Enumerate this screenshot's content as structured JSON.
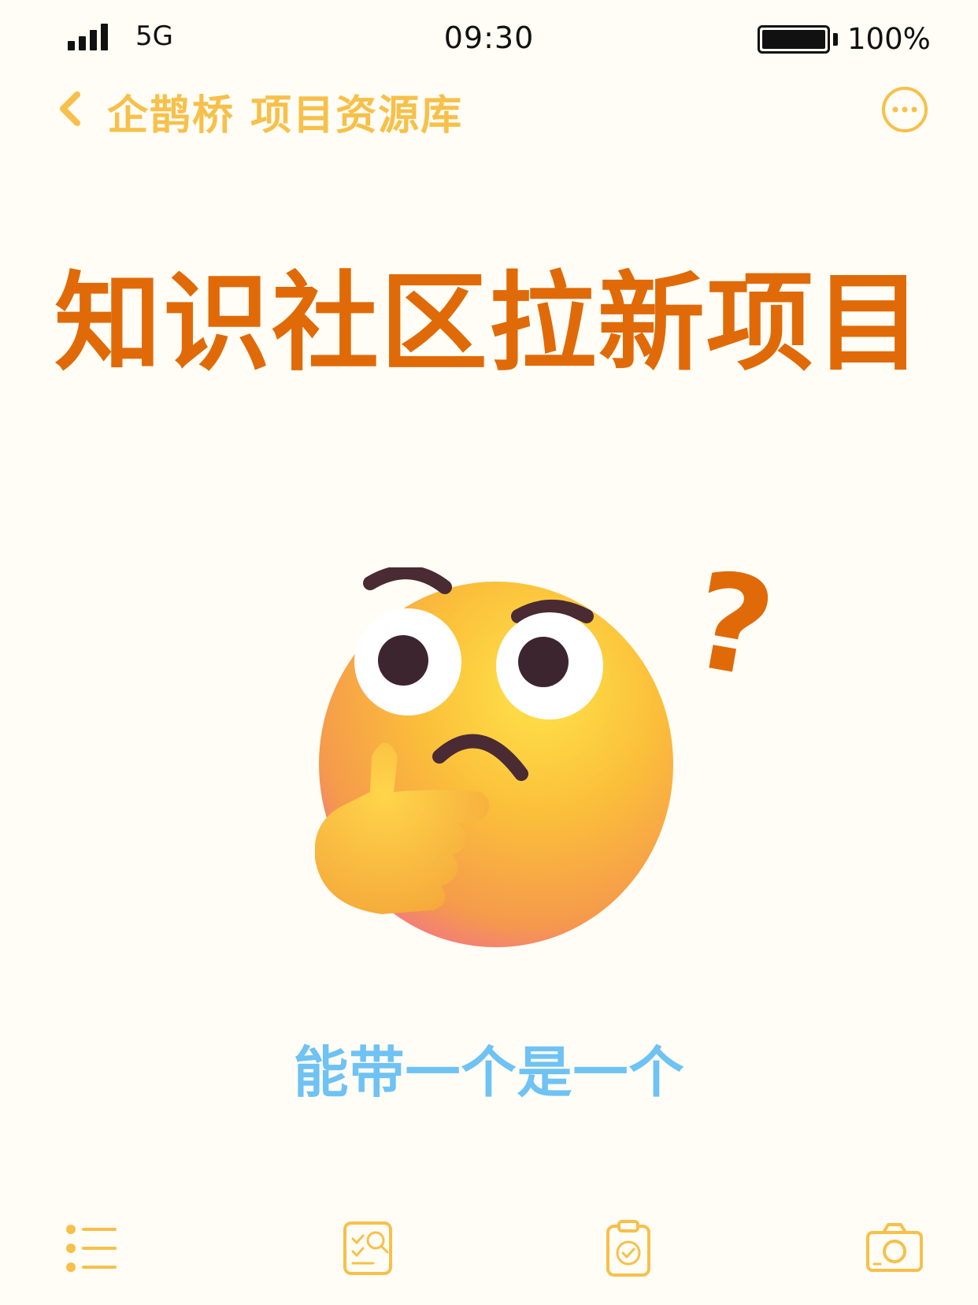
{
  "status_bar": {
    "network": "5G",
    "time": "09:30",
    "battery_level": 1.0,
    "battery_text": "100%"
  },
  "nav": {
    "title": "企鹊桥 项目资源库",
    "back_icon": "chevron-left-icon",
    "more_icon": "more-horizontal-icon"
  },
  "main": {
    "headline": "知识社区拉新项目",
    "emoji": "thinking-face-emoji",
    "question_mark": "?",
    "subtitle": "能带一个是一个"
  },
  "tab_bar": {
    "icons": [
      "list-icon",
      "checklist-search-icon",
      "clipboard-check-icon",
      "camera-icon"
    ]
  },
  "colors": {
    "background": "#fffdf5",
    "accent_yellow": "#f7c04a",
    "headline_orange": "#e06a08",
    "subtitle_blue": "#6ec2f4"
  }
}
